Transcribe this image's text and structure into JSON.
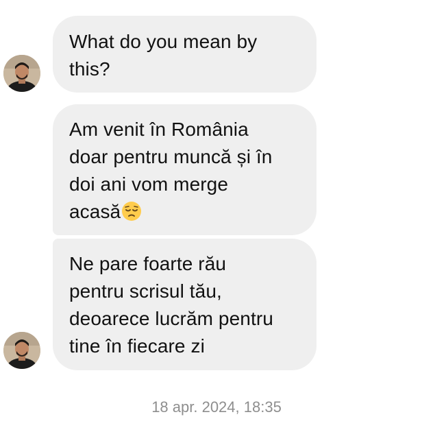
{
  "messages": [
    {
      "lines": [
        "What do you mean by",
        "this?"
      ]
    },
    {
      "lines": [
        "Am venit în România",
        "doar pentru muncă și în",
        "doi ani vom merge",
        "acasă"
      ],
      "trailing_emoji": "pensive-face-icon"
    },
    {
      "lines": [
        "Ne pare foarte rău",
        "pentru scrisul tău,",
        "deoarece lucrăm pentru",
        "tine în fiecare zi"
      ]
    }
  ],
  "timestamp": "18 apr. 2024, 18:35",
  "colors": {
    "bubble_background": "#efefef",
    "timestamp_text": "#8e8e8e",
    "emoji_face": "#ffcc4d"
  }
}
